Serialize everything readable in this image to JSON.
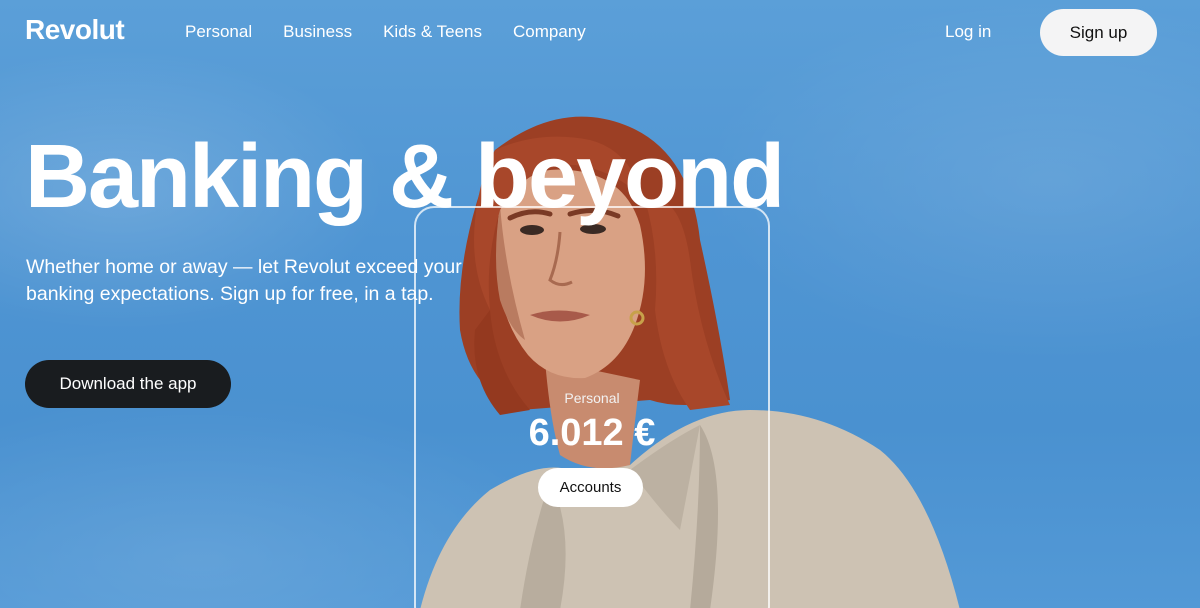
{
  "header": {
    "brand": "Revolut",
    "nav": [
      {
        "label": "Personal"
      },
      {
        "label": "Business"
      },
      {
        "label": "Kids & Teens"
      },
      {
        "label": "Company"
      }
    ],
    "login_label": "Log in",
    "signup_label": "Sign up"
  },
  "hero": {
    "headline": "Banking & beyond",
    "subtext": "Whether home or away — let Revolut exceed your banking expectations. Sign up for free, in a tap.",
    "cta_label": "Download the app"
  },
  "phone_card": {
    "label": "Personal",
    "balance": "6.012 €",
    "button_label": "Accounts"
  },
  "colors": {
    "sky": "#4f95d3",
    "cta_background": "#191c1f",
    "signup_background": "#f4f4f5",
    "hair": "#a8472a",
    "jacket": "#cfc4b5"
  }
}
